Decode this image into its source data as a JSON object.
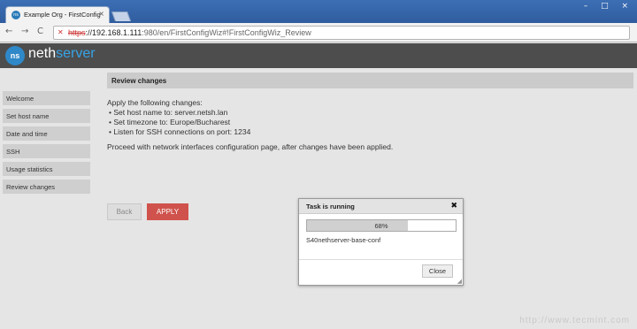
{
  "browser": {
    "tab_title": "Example Org - FirstConfig",
    "favicon": "ns",
    "tab_close": "×",
    "url_scheme": "https",
    "url_host": "://192.168.1.111",
    "url_path": ":980/en/FirstConfigWiz#!FirstConfigWiz_Review",
    "window_controls": "– □ ×",
    "back_icon": "←",
    "forward_icon": "→",
    "reload_icon": "C"
  },
  "app": {
    "logo_mark": "ns",
    "logo_part1": "neth",
    "logo_part2": "server",
    "accent_color": "#36a3e6",
    "header_color": "#4d4d4d"
  },
  "sidebar": {
    "items": [
      {
        "label": "Welcome"
      },
      {
        "label": "Set host name"
      },
      {
        "label": "Date and time"
      },
      {
        "label": "SSH"
      },
      {
        "label": "Usage statistics"
      },
      {
        "label": "Review changes"
      }
    ]
  },
  "main": {
    "title": "Review changes",
    "intro": "Apply the following changes:",
    "changes": [
      "• Set host name to: server.netsh.lan",
      "• Set timezone to: Europe/Bucharest",
      "• Listen for SSH connections on port: 1234"
    ],
    "proceed": "Proceed with network interfaces configuration page, after changes have been applied.",
    "back_label": "Back",
    "apply_label": "APPLY",
    "apply_color": "#d0524c"
  },
  "dialog": {
    "title": "Task is running",
    "close_icon": "✖",
    "progress_percent": 68,
    "progress_label": "68%",
    "task_name": "S40nethserver-base-conf",
    "close_label": "Close"
  },
  "watermark": "http://www.tecmint.com"
}
